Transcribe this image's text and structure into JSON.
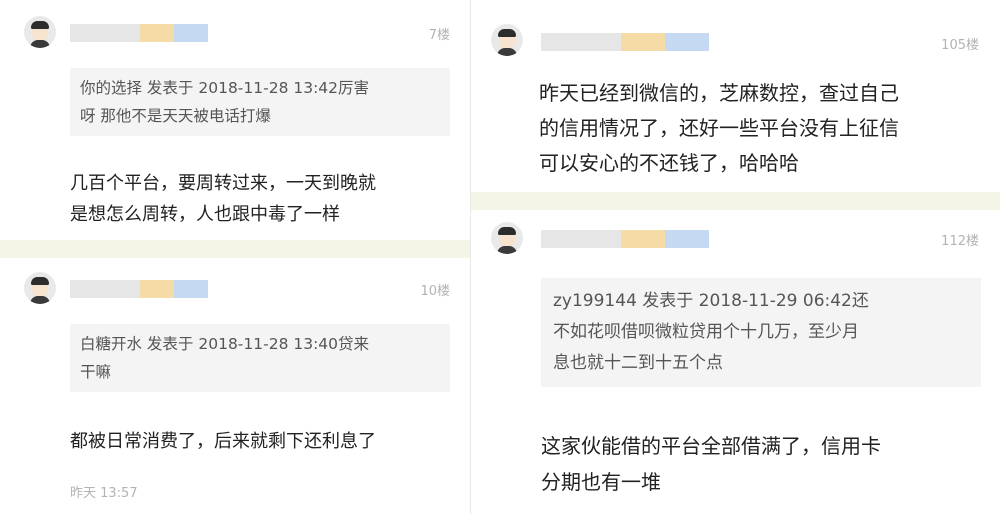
{
  "left_column": {
    "post_1": {
      "floor": "7楼",
      "quote": "你的选择 发表于 2018-11-28 13:42厉害\n呀 那他不是天天被电话打爆",
      "body": "几百个平台，要周转过来，一天到晚就\n是想怎么周转，人也跟中毒了一样"
    },
    "post_2": {
      "floor": "10楼",
      "quote": "白糖开水 发表于 2018-11-28 13:40贷来\n干嘛",
      "body": "都被日常消费了，后来就剩下还利息了",
      "time": "昨天 13:57"
    }
  },
  "right_column": {
    "post_1": {
      "floor": "105楼",
      "body": "昨天已经到微信的，芝麻数控，查过自己\n的信用情况了，还好一些平台没有上征信\n可以安心的不还钱了，哈哈哈"
    },
    "post_2": {
      "floor": "112楼",
      "quote": "zy199144 发表于 2018-11-29 06:42还\n不如花呗借呗微粒贷用个十几万，至少月\n息也就十二到十五个点",
      "body": "这家伙能借的平台全部借满了，信用卡\n分期也有一堆"
    }
  },
  "colors": {
    "divider": "#f4f4e7",
    "quote_bg": "#f4f4f4",
    "floor_text": "#b3b3b3",
    "body_text": "#222222"
  }
}
